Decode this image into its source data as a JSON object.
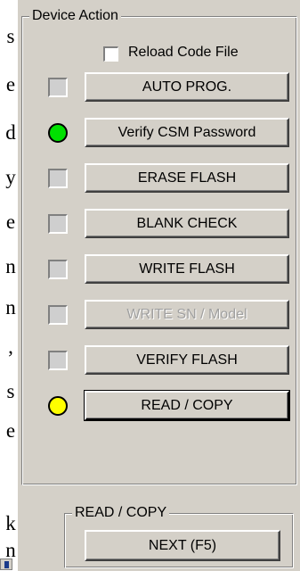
{
  "background_letters": [
    "s",
    "e",
    "d",
    "y",
    "e",
    "n",
    "n",
    ",",
    "s",
    "e",
    "k",
    "n"
  ],
  "device_action": {
    "title": "Device Action",
    "reload_checkbox": {
      "label": "Reload Code File",
      "checked": false
    },
    "buttons": [
      {
        "label": "AUTO PROG.",
        "indicator": "square",
        "indicator_color": "#cfcfcf",
        "enabled": true
      },
      {
        "label": "Verify CSM Password",
        "indicator": "circle",
        "indicator_color": "#00e000",
        "enabled": true
      },
      {
        "label": "ERASE FLASH",
        "indicator": "square",
        "indicator_color": "#cfcfcf",
        "enabled": true
      },
      {
        "label": "BLANK CHECK",
        "indicator": "square",
        "indicator_color": "#cfcfcf",
        "enabled": true
      },
      {
        "label": "WRITE FLASH",
        "indicator": "square",
        "indicator_color": "#cfcfcf",
        "enabled": true
      },
      {
        "label": "WRITE SN / Model",
        "indicator": "square",
        "indicator_color": "#cfcfcf",
        "enabled": false
      },
      {
        "label": "VERIFY FLASH",
        "indicator": "square",
        "indicator_color": "#cfcfcf",
        "enabled": true
      },
      {
        "label": "READ / COPY",
        "indicator": "circle",
        "indicator_color": "#ffff00",
        "enabled": true,
        "focused": true
      }
    ]
  },
  "read_copy": {
    "title": "READ / COPY",
    "next_label": "NEXT  (F5)"
  }
}
